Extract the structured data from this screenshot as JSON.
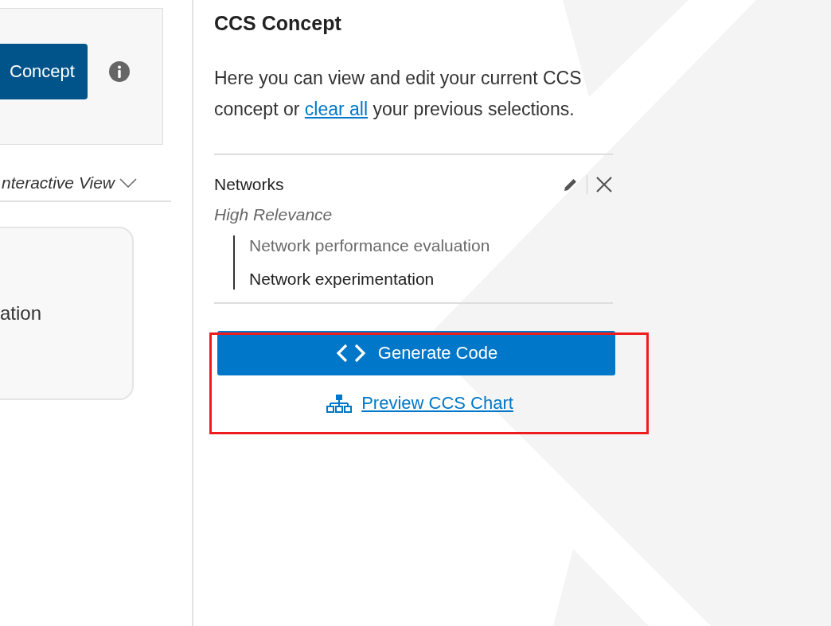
{
  "left_panel": {
    "concept_button": "Concept",
    "view_selector": "nteractive View",
    "card_text": "ation"
  },
  "concept_panel": {
    "title": "CCS Concept",
    "intro_before": "Here you can view and edit your current CCS concept or ",
    "intro_link": "clear all",
    "intro_after": " your previous selections.",
    "categories": [
      {
        "name": "Networks",
        "relevance": "High Relevance",
        "items": [
          {
            "label": "Network performance evaluation",
            "selected": false
          },
          {
            "label": "Network experimentation",
            "selected": true
          }
        ]
      }
    ],
    "generate_button": "Generate Code",
    "preview_link": "Preview CCS Chart"
  }
}
